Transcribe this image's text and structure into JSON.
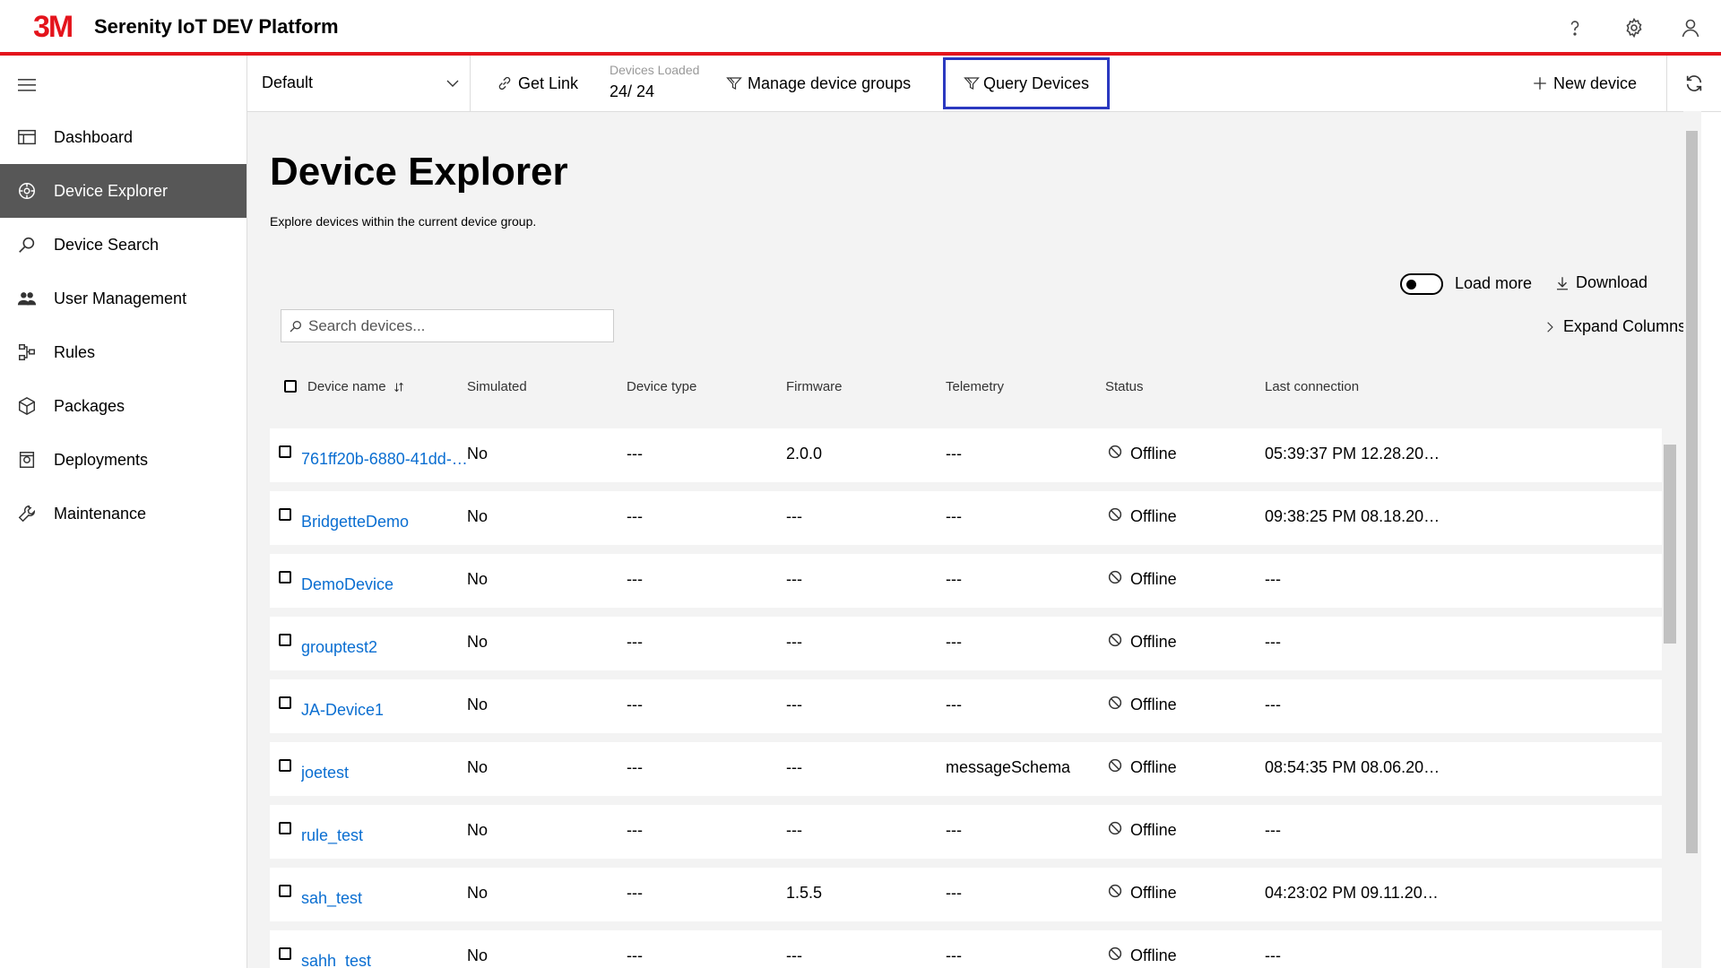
{
  "header": {
    "logo": "3M",
    "title": "Serenity IoT DEV Platform",
    "icons": [
      "help-icon",
      "gear-icon",
      "user-icon"
    ]
  },
  "sidebar": {
    "items": [
      {
        "label": "Dashboard",
        "icon": "dashboard-icon"
      },
      {
        "label": "Device Explorer",
        "icon": "device-explorer-icon",
        "active": true
      },
      {
        "label": "Device Search",
        "icon": "search-icon"
      },
      {
        "label": "User Management",
        "icon": "users-icon"
      },
      {
        "label": "Rules",
        "icon": "rules-icon"
      },
      {
        "label": "Packages",
        "icon": "package-icon"
      },
      {
        "label": "Deployments",
        "icon": "deployments-icon"
      },
      {
        "label": "Maintenance",
        "icon": "wrench-icon"
      }
    ]
  },
  "toolbar": {
    "group": "Default",
    "get_link": "Get Link",
    "devices_loaded_label": "Devices Loaded",
    "devices_loaded_count": "24/ 24",
    "manage_groups": "Manage device groups",
    "query_devices": "Query Devices",
    "new_device": "New device"
  },
  "page": {
    "title": "Device Explorer",
    "subtitle": "Explore devices within the current device group.",
    "load_more": "Load more",
    "download": "Download",
    "expand_columns": "Expand Columns",
    "search_placeholder": "Search devices..."
  },
  "table": {
    "columns": [
      "Device name",
      "Simulated",
      "Device type",
      "Firmware",
      "Telemetry",
      "Status",
      "Last connection"
    ],
    "rows": [
      {
        "name": "761ff20b-6880-41dd-…",
        "simulated": "No",
        "type": "---",
        "firmware": "2.0.0",
        "telemetry": "---",
        "status": "Offline",
        "last": "05:39:37 PM 12.28.20…"
      },
      {
        "name": "BridgetteDemo",
        "simulated": "No",
        "type": "---",
        "firmware": "---",
        "telemetry": "---",
        "status": "Offline",
        "last": "09:38:25 PM 08.18.20…"
      },
      {
        "name": "DemoDevice",
        "simulated": "No",
        "type": "---",
        "firmware": "---",
        "telemetry": "---",
        "status": "Offline",
        "last": "---"
      },
      {
        "name": "grouptest2",
        "simulated": "No",
        "type": "---",
        "firmware": "---",
        "telemetry": "---",
        "status": "Offline",
        "last": "---"
      },
      {
        "name": "JA-Device1",
        "simulated": "No",
        "type": "---",
        "firmware": "---",
        "telemetry": "---",
        "status": "Offline",
        "last": "---"
      },
      {
        "name": "joetest",
        "simulated": "No",
        "type": "---",
        "firmware": "---",
        "telemetry": "messageSchema",
        "status": "Offline",
        "last": "08:54:35 PM 08.06.20…"
      },
      {
        "name": "rule_test",
        "simulated": "No",
        "type": "---",
        "firmware": "---",
        "telemetry": "---",
        "status": "Offline",
        "last": "---"
      },
      {
        "name": "sah_test",
        "simulated": "No",
        "type": "---",
        "firmware": "1.5.5",
        "telemetry": "---",
        "status": "Offline",
        "last": "04:23:02 PM 09.11.20…"
      },
      {
        "name": "sahh_test",
        "simulated": "No",
        "type": "---",
        "firmware": "---",
        "telemetry": "---",
        "status": "Offline",
        "last": "---"
      }
    ]
  },
  "colors": {
    "brand": "#e4141c",
    "link": "#0a6ed1",
    "highlight": "#2b39c0",
    "active_nav": "#575757"
  }
}
